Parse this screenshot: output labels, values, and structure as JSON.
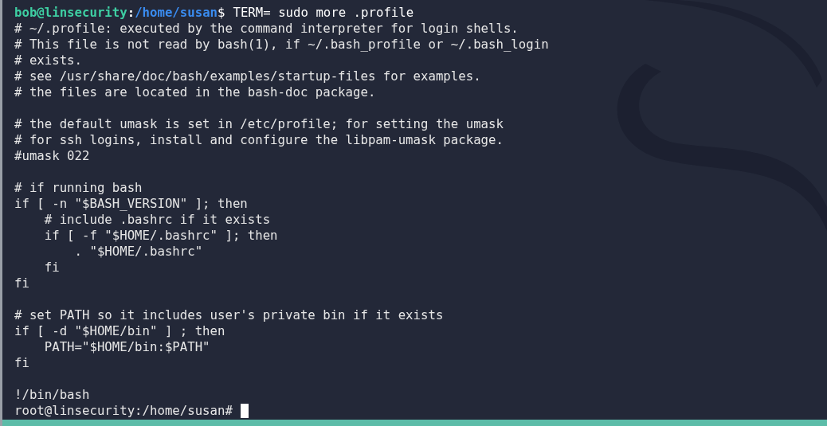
{
  "terminal": {
    "lines": [
      {
        "kind": "prompt",
        "user": "bob@linsecurity",
        "separator": ":",
        "path": "/home/susan",
        "symbol": "$",
        "command": "TERM= sudo more .profile"
      },
      {
        "kind": "text",
        "text": "# ~/.profile: executed by the command interpreter for login shells."
      },
      {
        "kind": "text",
        "text": "# This file is not read by bash(1), if ~/.bash_profile or ~/.bash_login"
      },
      {
        "kind": "text",
        "text": "# exists."
      },
      {
        "kind": "text",
        "text": "# see /usr/share/doc/bash/examples/startup-files for examples."
      },
      {
        "kind": "text",
        "text": "# the files are located in the bash-doc package."
      },
      {
        "kind": "blank"
      },
      {
        "kind": "text",
        "text": "# the default umask is set in /etc/profile; for setting the umask"
      },
      {
        "kind": "text",
        "text": "# for ssh logins, install and configure the libpam-umask package."
      },
      {
        "kind": "text",
        "text": "#umask 022"
      },
      {
        "kind": "blank"
      },
      {
        "kind": "text",
        "text": "# if running bash"
      },
      {
        "kind": "text",
        "text": "if [ -n \"$BASH_VERSION\" ]; then"
      },
      {
        "kind": "text",
        "text": "    # include .bashrc if it exists"
      },
      {
        "kind": "text",
        "text": "    if [ -f \"$HOME/.bashrc\" ]; then"
      },
      {
        "kind": "text",
        "text": "        . \"$HOME/.bashrc\""
      },
      {
        "kind": "text",
        "text": "    fi"
      },
      {
        "kind": "text",
        "text": "fi"
      },
      {
        "kind": "blank"
      },
      {
        "kind": "text",
        "text": "# set PATH so it includes user's private bin if it exists"
      },
      {
        "kind": "text",
        "text": "if [ -d \"$HOME/bin\" ] ; then"
      },
      {
        "kind": "text",
        "text": "    PATH=\"$HOME/bin:$PATH\""
      },
      {
        "kind": "text",
        "text": "fi"
      },
      {
        "kind": "blank"
      },
      {
        "kind": "text",
        "text": "!/bin/bash"
      },
      {
        "kind": "root_prompt",
        "text": "root@linsecurity:/home/susan#",
        "cursor": true
      }
    ]
  },
  "status_bar": {
    "visible": true
  }
}
